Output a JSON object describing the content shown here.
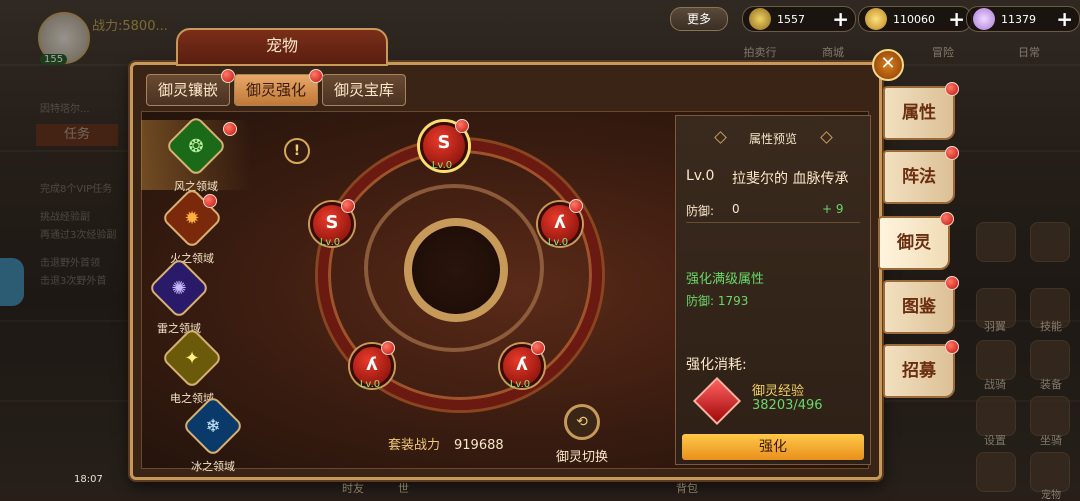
{
  "top": {
    "power_text": "战力:5800...",
    "avatar_level": "155",
    "more_label": "更多",
    "res1": "1557",
    "res2": "110060",
    "res3": "11379",
    "plus": "+"
  },
  "background": {
    "task_label": "任务",
    "line1": "因特塔尔...",
    "line2": "完成8个VIP任务",
    "line3": "挑战经验副",
    "line4": "再通过3次经验副",
    "line5": "击退野外首领",
    "line6": "击退3次野外首",
    "right_labels": [
      "拍卖行",
      "商城",
      "冒险",
      "日常",
      "羽翼",
      "技能",
      "战骑",
      "装备",
      "设置",
      "坐骑",
      "宠物"
    ],
    "bottom_labels": [
      "时友",
      "世",
      "背包"
    ],
    "time": "18:07"
  },
  "panel": {
    "title": "宠物",
    "close": "✕",
    "tabs": [
      "御灵镶嵌",
      "御灵强化",
      "御灵宝库"
    ],
    "active_tab": 1
  },
  "domains": [
    {
      "label": "风之领域",
      "symbol": "❂",
      "color": "#3aa83a"
    },
    {
      "label": "火之领域",
      "symbol": "✹",
      "color": "#e8641c"
    },
    {
      "label": "雷之领域",
      "symbol": "✺",
      "color": "#6a4ad8"
    },
    {
      "label": "电之领域",
      "symbol": "✦",
      "color": "#e8c82a"
    },
    {
      "label": "冰之领域",
      "symbol": "❄",
      "color": "#3a9ae8"
    }
  ],
  "nodes": {
    "lv": "Lv.0",
    "top_symbol": "S",
    "other_symbol": "ʎ"
  },
  "warn_symbol": "!",
  "set_power": {
    "label": "套装战力",
    "value": "919688"
  },
  "switch_label": "御灵切换",
  "attr": {
    "title": "属性预览",
    "lv": "Lv.0",
    "name": "拉斐尔的 血脉传承",
    "def_label": "防御:",
    "def_value": "0",
    "def_inc": "+ 9",
    "max_title": "强化满级属性",
    "max_def": "防御: 1793",
    "cost_title": "强化消耗:",
    "cost_name": "御灵经验",
    "cost_value": "38203/496",
    "enhance_btn": "强化"
  },
  "right_tabs": [
    "属性",
    "阵法",
    "御灵",
    "图鉴",
    "招募"
  ],
  "right_tab_active": 2,
  "colors": {
    "accent_gold": "#c89a5a",
    "green_text": "#68d868",
    "red_dot": "#c4140c",
    "btn_orange": "#ffc848"
  }
}
